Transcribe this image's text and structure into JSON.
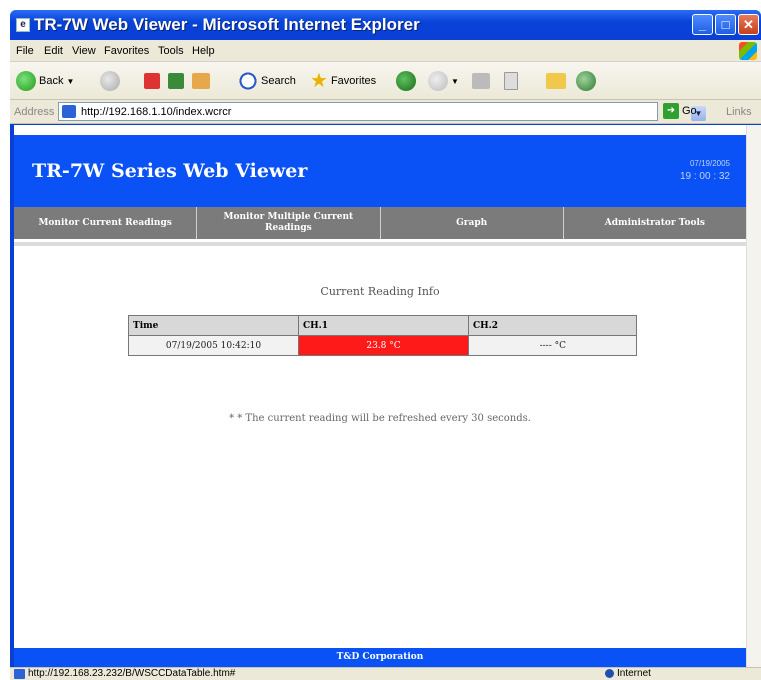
{
  "window": {
    "title": "TR-7W Web Viewer - Microsoft Internet Explorer",
    "min_label": "_",
    "max_label": "□",
    "close_label": "✕"
  },
  "menu": {
    "items": [
      "File",
      "Edit",
      "View",
      "Favorites",
      "Tools",
      "Help"
    ]
  },
  "toolbar": {
    "back_label": "Back",
    "search_label": "Search",
    "favorites_label": "Favorites"
  },
  "address": {
    "label": "Address",
    "url": "http://192.168.1.10/index.wcrcr",
    "go_label": "Go",
    "links_label": "Links"
  },
  "site": {
    "title": "TR-7W Series Web Viewer",
    "date": "07/19/2005",
    "time": "19 : 00 : 32",
    "nav": [
      "Monitor Current Readings",
      "Monitor Multiple Current Readings",
      "Graph",
      "Administrator Tools"
    ],
    "section_title": "Current Reading Info",
    "table": {
      "headers": [
        "Time",
        "CH.1",
        "CH.2"
      ],
      "rows": [
        [
          "07/19/2005 10:42:10",
          "23.8 °C",
          "---- °C"
        ]
      ]
    },
    "note": "* * The current reading will be refreshed every 30 seconds.",
    "footer": "T&D Corporation"
  },
  "status": {
    "text": "http://192.168.23.232/B/WSCCDataTable.htm#",
    "zone": "Internet"
  },
  "colors": {
    "header_blue": "#0a52f5",
    "nav_gray": "#7b7b7b",
    "alarm_red": "#ff1a1a"
  }
}
